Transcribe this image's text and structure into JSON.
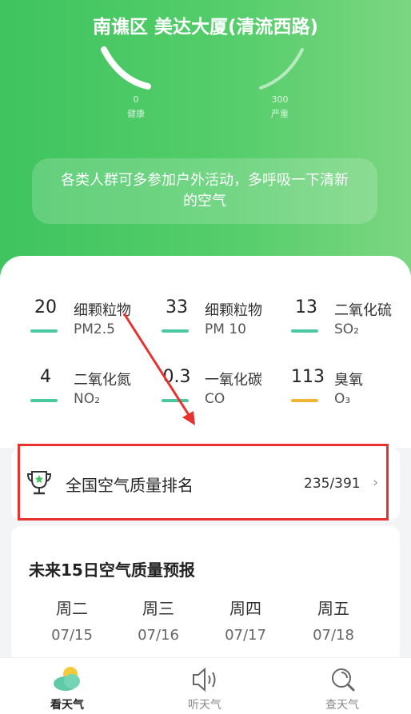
{
  "header": {
    "location": "南谯区 美达大厦(清流西路)",
    "gauge_min": "0",
    "gauge_min_label": "健康",
    "gauge_max": "300",
    "gauge_max_label": "严重"
  },
  "advice": "各类人群可多参加户外活动，多呼吸一下清新的空气",
  "pollutants": [
    {
      "value": "20",
      "name": "细颗粒物",
      "sub": "PM2.5",
      "color": "#4cc9a0"
    },
    {
      "value": "33",
      "name": "细颗粒物",
      "sub": "PM 10",
      "color": "#4cc9a0"
    },
    {
      "value": "13",
      "name": "二氧化硫",
      "sub": "SO₂",
      "color": "#4cc9a0"
    },
    {
      "value": "4",
      "name": "二氧化氮",
      "sub": "NO₂",
      "color": "#4cc9a0"
    },
    {
      "value": "0.3",
      "name": "一氧化碳",
      "sub": "CO",
      "color": "#4cc9a0"
    },
    {
      "value": "113",
      "name": "臭氧",
      "sub": "O₃",
      "color": "#f2b533"
    }
  ],
  "ranking": {
    "title": "全国空气质量排名",
    "value": "235/391",
    "chevron": "›"
  },
  "forecast": {
    "title": "未来15日空气质量预报",
    "days": [
      {
        "day": "周二",
        "date": "07/15"
      },
      {
        "day": "周三",
        "date": "07/16"
      },
      {
        "day": "周四",
        "date": "07/17"
      },
      {
        "day": "周五",
        "date": "07/18"
      }
    ]
  },
  "nav": [
    {
      "label": "看天气",
      "icon": "weather-cloud-icon",
      "active": true
    },
    {
      "label": "听天气",
      "icon": "speaker-icon",
      "active": false
    },
    {
      "label": "查天气",
      "icon": "search-icon",
      "active": false
    }
  ],
  "colors": {
    "hero_green": "#4ec966",
    "highlight_red": "#e8322f",
    "good_bar": "#4cc9a0",
    "ozone_bar": "#f2b533"
  }
}
